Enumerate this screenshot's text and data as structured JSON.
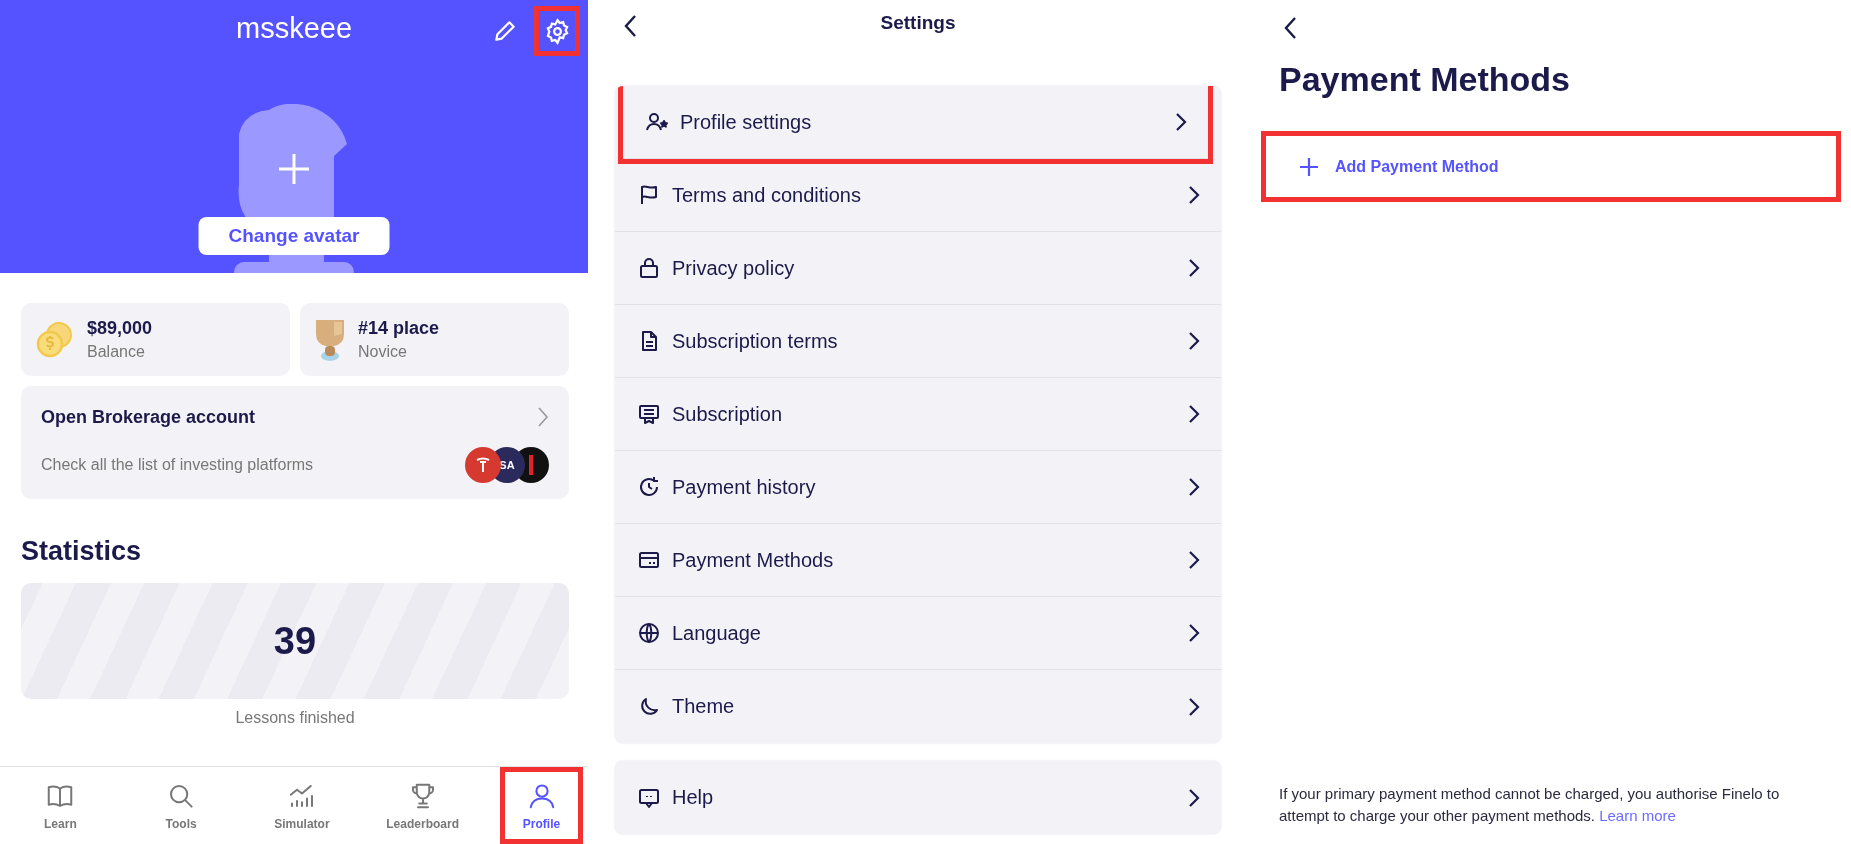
{
  "profile": {
    "username": "msskeee",
    "edit_highlighted": false,
    "settings_highlighted": true,
    "avatar_button": "Change avatar",
    "stats_cards": [
      {
        "kind": "coins",
        "value": "$89,000",
        "label": "Balance"
      },
      {
        "kind": "trophy",
        "value": "#14 place",
        "label": "Novice"
      }
    ],
    "brokerage": {
      "title": "Open Brokerage account",
      "subtitle": "Check all the list of investing platforms",
      "logos": [
        {
          "kind": "tesla",
          "color": "#d6392f"
        },
        {
          "kind": "text",
          "color": "#2b2a5c",
          "text": "SA"
        },
        {
          "kind": "bar",
          "color": "#111111"
        }
      ]
    },
    "statistics": {
      "heading": "Statistics",
      "value": "39",
      "label": "Lessons finished"
    },
    "nav": [
      {
        "kind": "book",
        "label": "Learn",
        "selected": false,
        "highlighted": false
      },
      {
        "kind": "search",
        "label": "Tools",
        "selected": false,
        "highlighted": false
      },
      {
        "kind": "chart",
        "label": "Simulator",
        "selected": false,
        "highlighted": false
      },
      {
        "kind": "trophy",
        "label": "Leaderboard",
        "selected": false,
        "highlighted": false
      },
      {
        "kind": "user",
        "label": "Profile",
        "selected": true,
        "highlighted": true
      }
    ]
  },
  "settings": {
    "title": "Settings",
    "items": [
      {
        "kind": "user-star",
        "label": "Profile settings",
        "highlighted": true
      },
      {
        "kind": "flag",
        "label": "Terms and conditions",
        "highlighted": false
      },
      {
        "kind": "lock",
        "label": "Privacy policy",
        "highlighted": false
      },
      {
        "kind": "document",
        "label": "Subscription terms",
        "highlighted": false
      },
      {
        "kind": "receipt",
        "label": "Subscription",
        "highlighted": false
      },
      {
        "kind": "history",
        "label": "Payment history",
        "highlighted": false
      },
      {
        "kind": "card",
        "label": "Payment Methods",
        "highlighted": false
      },
      {
        "kind": "globe",
        "label": "Language",
        "highlighted": false
      },
      {
        "kind": "moon",
        "label": "Theme",
        "highlighted": false
      }
    ],
    "help": {
      "kind": "chat",
      "label": "Help",
      "highlighted": false
    }
  },
  "payment": {
    "title": "Payment Methods",
    "add_button": {
      "label": "Add Payment Method",
      "highlighted": true
    },
    "note": "If your primary payment method cannot be charged, you authorise Finelo to attempt to charge your other payment methods.",
    "note_link": "Learn more"
  }
}
